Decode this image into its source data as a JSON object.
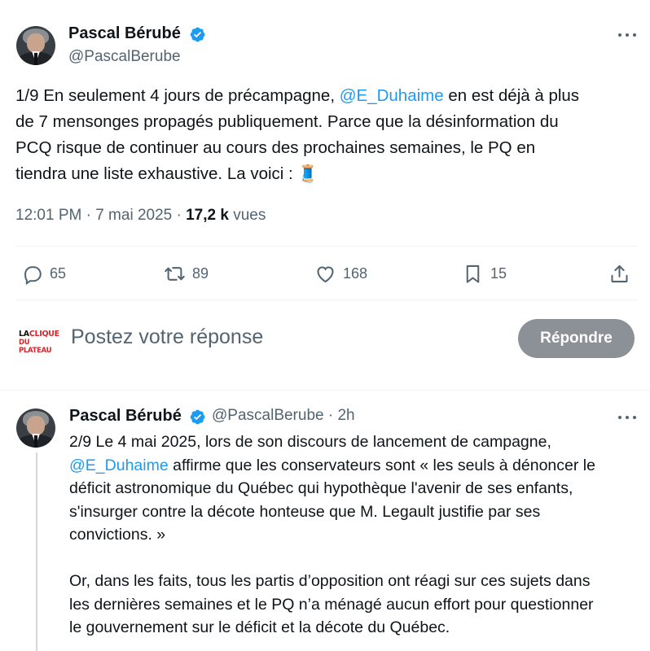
{
  "tweet": {
    "author_name": "Pascal Bérubé",
    "author_handle": "@PascalBerube",
    "text_lines": [
      {
        "before": "1/9 En seulement 4 jours de précampagne, ",
        "mention": "@E_Duhaime",
        "after": "  en est déjà à plus"
      },
      {
        "before": "de 7 mensonges propagés publiquement. Parce que la désinformation du",
        "mention": "",
        "after": ""
      },
      {
        "before": "PCQ risque de continuer au cours des prochaines semaines, le PQ en",
        "mention": "",
        "after": ""
      },
      {
        "before": "tiendra une liste exhaustive. La voici : ",
        "mention": "",
        "after": "🧵"
      }
    ],
    "timestamp": "12:01 PM · 7 mai 2025 · ",
    "views_count": "17,2 k",
    "views_label": " vues",
    "actions": {
      "replies": "65",
      "reposts": "89",
      "likes": "168",
      "bookmarks": "15"
    }
  },
  "reply_box": {
    "logo_line1_a": "LA",
    "logo_line1_b": "CLIQUE",
    "logo_line2": "DU PLATEAU",
    "placeholder": "Postez votre réponse",
    "button_label": "Répondre"
  },
  "thread_reply": {
    "author_name": "Pascal Bérubé",
    "author_handle": "@PascalBerube",
    "time": " · 2h",
    "lines": [
      {
        "before": "2/9 Le 4 mai 2025, lors de son discours de lancement de campagne,",
        "mention": "",
        "after": ""
      },
      {
        "before": "",
        "mention": "@E_Duhaime",
        "after": " affirme que les conservateurs sont « les seuls à dénoncer le"
      },
      {
        "before": "déficit astronomique du Québec qui hypothèque l'avenir de ses enfants,",
        "mention": "",
        "after": ""
      },
      {
        "before": "s'insurger contre la décote honteuse que M. Legault justifie par ses",
        "mention": "",
        "after": ""
      },
      {
        "before": "convictions. »",
        "mention": "",
        "after": ""
      }
    ],
    "lines2": [
      "Or, dans les faits, tous les partis d’opposition ont réagi sur ces sujets dans",
      "les dernières semaines et le PQ n’a ménagé aucun effort pour questionner",
      "le gouvernement sur le déficit et la décote du Québec."
    ]
  },
  "colors": {
    "accent": "#1d9bf0",
    "text": "#0f1419",
    "secondary": "#536471",
    "button_disabled": "#8b9196"
  },
  "icons": [
    "verified-badge-icon",
    "more-icon",
    "reply-icon",
    "repost-icon",
    "like-icon",
    "bookmark-icon",
    "share-icon",
    "thread-emoji"
  ]
}
